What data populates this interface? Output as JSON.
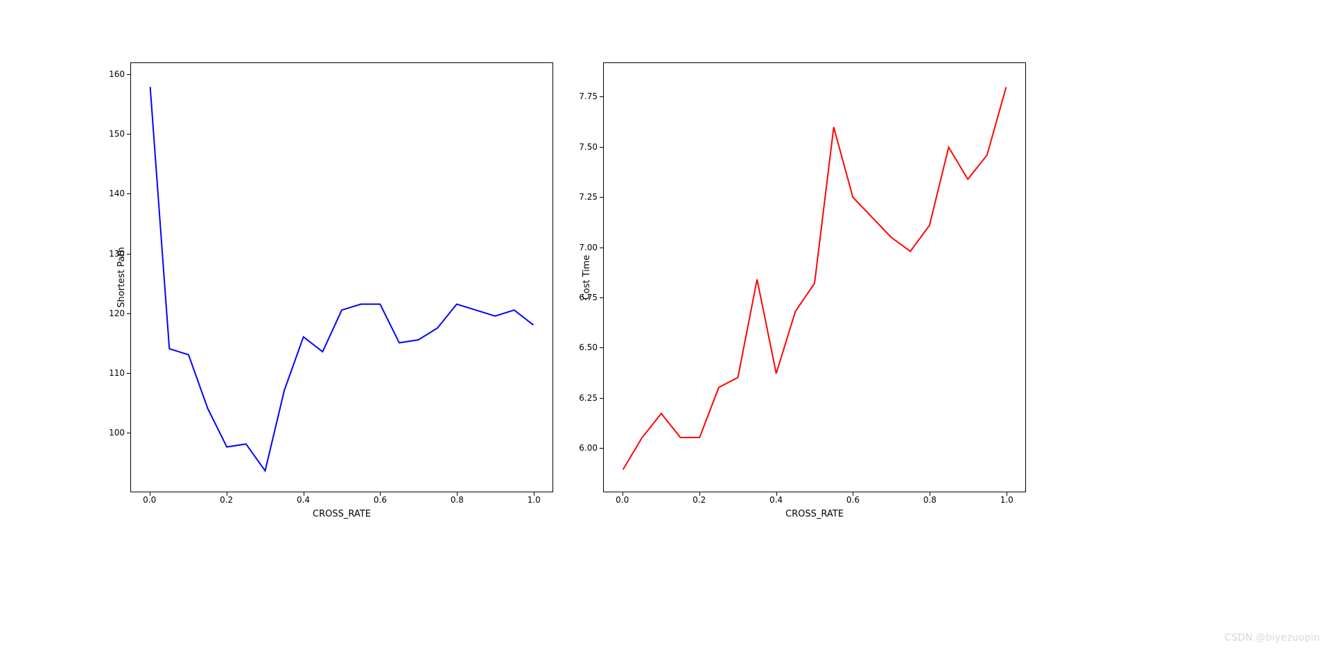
{
  "chart_data": [
    {
      "type": "line",
      "xlabel": "CROSS_RATE",
      "ylabel": "Shortest Path",
      "color": "#0000ff",
      "xlim": [
        -0.05,
        1.05
      ],
      "ylim": [
        90,
        162
      ],
      "xticks": [
        0.0,
        0.2,
        0.4,
        0.6,
        0.8,
        1.0
      ],
      "yticks": [
        100,
        110,
        120,
        130,
        140,
        150,
        160
      ],
      "x": [
        0.0,
        0.05,
        0.1,
        0.15,
        0.2,
        0.25,
        0.3,
        0.35,
        0.4,
        0.45,
        0.5,
        0.55,
        0.6,
        0.65,
        0.7,
        0.75,
        0.8,
        0.85,
        0.9,
        0.95,
        1.0
      ],
      "values": [
        158,
        114,
        113,
        104,
        97.5,
        98,
        93.5,
        107,
        116,
        113.5,
        120.5,
        121.5,
        121.5,
        115,
        115.5,
        117.5,
        121.5,
        120.5,
        119.5,
        120.5,
        118
      ]
    },
    {
      "type": "line",
      "xlabel": "CROSS_RATE",
      "ylabel": "Cost Time",
      "color": "#ff0000",
      "xlim": [
        -0.05,
        1.05
      ],
      "ylim": [
        5.78,
        7.92
      ],
      "xticks": [
        0.0,
        0.2,
        0.4,
        0.6,
        0.8,
        1.0
      ],
      "yticks": [
        6.0,
        6.25,
        6.5,
        6.75,
        7.0,
        7.25,
        7.5,
        7.75
      ],
      "x": [
        0.0,
        0.05,
        0.1,
        0.15,
        0.2,
        0.25,
        0.3,
        0.35,
        0.4,
        0.45,
        0.5,
        0.55,
        0.6,
        0.65,
        0.7,
        0.75,
        0.8,
        0.85,
        0.9,
        0.95,
        1.0
      ],
      "values": [
        5.89,
        6.05,
        6.17,
        6.05,
        6.05,
        6.3,
        6.35,
        6.84,
        6.37,
        6.68,
        6.82,
        7.6,
        7.25,
        7.15,
        7.05,
        6.98,
        7.11,
        7.5,
        7.34,
        7.46,
        7.8
      ]
    }
  ],
  "watermark": "CSDN @biyezuopin"
}
